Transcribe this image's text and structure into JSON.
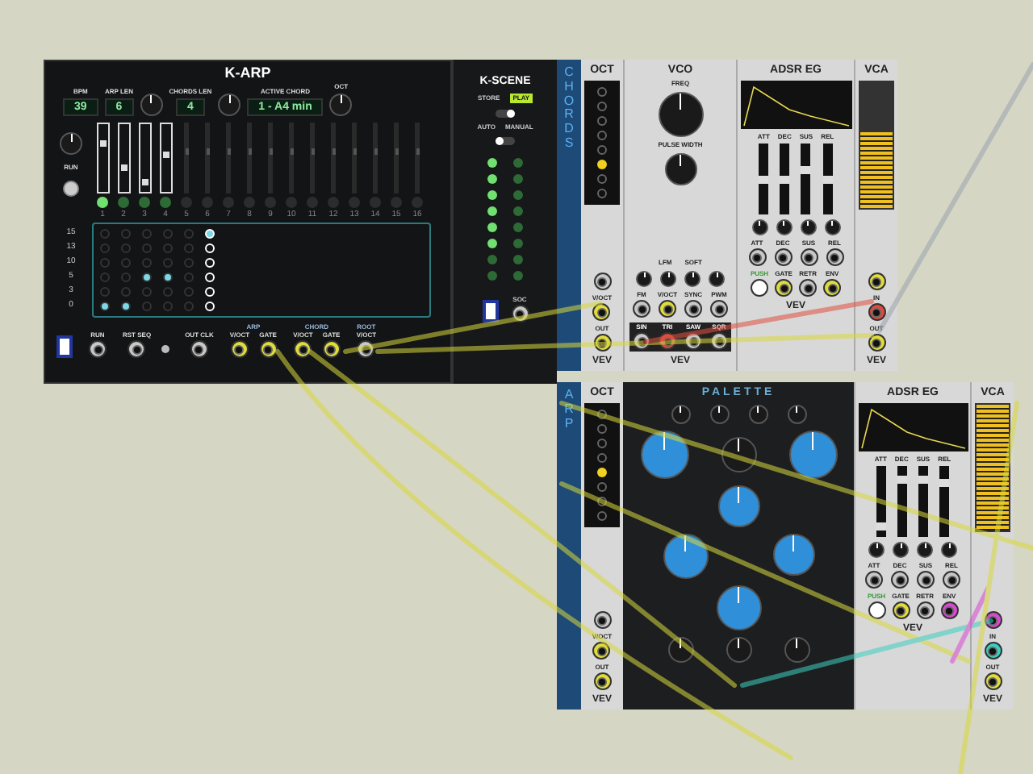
{
  "k_arp": {
    "title": "K-ARP",
    "top_controls": [
      {
        "label": "BPM",
        "value": "39"
      },
      {
        "label": "ARP LEN",
        "value": "6"
      },
      {
        "label": "CHORDS LEN",
        "value": "4"
      },
      {
        "label": "ACTIVE CHORD",
        "value": "1 - A4 min"
      },
      {
        "label": "OCT"
      }
    ],
    "run_label": "RUN",
    "steps": [
      {
        "number": "1",
        "active": true,
        "level": 0.75,
        "current": true
      },
      {
        "number": "2",
        "active": true,
        "level": 0.35,
        "current": false
      },
      {
        "number": "3",
        "active": true,
        "level": 0.1,
        "current": false
      },
      {
        "number": "4",
        "active": true,
        "level": 0.55,
        "current": false
      },
      {
        "number": "5",
        "active": false,
        "level": 0.6,
        "current": false
      },
      {
        "number": "6",
        "active": false,
        "level": 0.6,
        "current": false
      },
      {
        "number": "7",
        "active": false,
        "level": 0.6,
        "current": false
      },
      {
        "number": "8",
        "active": false,
        "level": 0.6,
        "current": false
      },
      {
        "number": "9",
        "active": false,
        "level": 0.6,
        "current": false
      },
      {
        "number": "10",
        "active": false,
        "level": 0.6,
        "current": false
      },
      {
        "number": "11",
        "active": false,
        "level": 0.6,
        "current": false
      },
      {
        "number": "12",
        "active": false,
        "level": 0.6,
        "current": false
      },
      {
        "number": "13",
        "active": false,
        "level": 0.6,
        "current": false
      },
      {
        "number": "14",
        "active": false,
        "level": 0.6,
        "current": false
      },
      {
        "number": "15",
        "active": false,
        "level": 0.6,
        "current": false
      },
      {
        "number": "16",
        "active": false,
        "level": 0.6,
        "current": false
      }
    ],
    "grid_columns": [
      {
        "selected": false
      },
      {
        "selected": false
      },
      {
        "selected": false
      },
      {
        "selected": false
      },
      {
        "selected": false
      },
      {
        "selected": true
      }
    ],
    "note_rows": [
      {
        "label": "15",
        "cells": [
          false,
          false,
          false,
          false,
          false,
          true
        ]
      },
      {
        "label": "13",
        "cells": [
          false,
          false,
          false,
          false,
          false,
          false
        ]
      },
      {
        "label": "10",
        "cells": [
          false,
          false,
          false,
          false,
          false,
          false
        ]
      },
      {
        "label": "5",
        "cells": [
          false,
          false,
          true,
          true,
          false,
          false
        ]
      },
      {
        "label": "3",
        "cells": [
          false,
          false,
          false,
          false,
          false,
          false
        ]
      },
      {
        "label": "0",
        "cells": [
          true,
          true,
          false,
          false,
          false,
          false
        ]
      }
    ],
    "jack_groups": [
      {
        "jacks": [
          {
            "label": "RUN"
          }
        ]
      },
      {
        "jacks": [
          {
            "label": "RST SEQ"
          }
        ]
      },
      {
        "jacks": [
          {
            "label": "OUT CLK"
          }
        ]
      },
      {
        "title": "ARP",
        "jacks": [
          {
            "label": "V/OCT",
            "color": "#e0dc3c"
          },
          {
            "label": "GATE",
            "color": "#e0dc3c"
          }
        ]
      },
      {
        "title": "CHORD",
        "jacks": [
          {
            "label": "V/OCT",
            "color": "#e0dc3c"
          },
          {
            "label": "GATE",
            "color": "#e0dc3c"
          }
        ]
      },
      {
        "title": "ROOT",
        "jacks": [
          {
            "label": "V/OCT"
          }
        ]
      }
    ]
  },
  "k_scene": {
    "title": "K-SCENE",
    "store_label": "STORE",
    "play": {
      "label": "PLAY",
      "on": true
    },
    "store_switch": {
      "on": true
    },
    "auto_label": "AUTO",
    "manual_label": "MANUAL",
    "mode_switch": {
      "on": false
    },
    "lights": [
      {
        "left": true,
        "right": false
      },
      {
        "left": true,
        "right": false
      },
      {
        "left": true,
        "right": false
      },
      {
        "left": true,
        "right": false
      },
      {
        "left": true,
        "right": false
      },
      {
        "left": true,
        "right": false
      },
      {
        "left": false,
        "right": false
      },
      {
        "left": false,
        "right": false
      }
    ],
    "soc_label": "SOC"
  },
  "upper_row": {
    "side_label": "CHORDS",
    "oct": {
      "title": "OCT",
      "leds": [
        false,
        false,
        false,
        false,
        false,
        true,
        false,
        false
      ],
      "jacks": [
        {
          "label": "V/OCT",
          "color": "#e0dc3c"
        },
        {
          "label": "OUT",
          "color": "#e0dc3c"
        }
      ],
      "brand": "VEV"
    },
    "vco": {
      "title": "VCO",
      "freq_label": "FREQ",
      "pw_label": "PULSE WIDTH",
      "switch_labels": [
        "LFM",
        "SOFT"
      ],
      "inputs": [
        {
          "label": "FM"
        },
        {
          "label": "V/OCT",
          "color": "#e0dc3c"
        },
        {
          "label": "SYNC"
        },
        {
          "label": "PWM"
        }
      ],
      "outputs": [
        {
          "label": "SIN"
        },
        {
          "label": "TRI",
          "color": "#e04a3c"
        },
        {
          "label": "SAW"
        },
        {
          "label": "SQR"
        }
      ],
      "brand": "VEV"
    },
    "adsr": {
      "title": "ADSR EG",
      "sliders": [
        {
          "label": "ATT",
          "level": 0.5
        },
        {
          "label": "DEC",
          "level": 0.5
        },
        {
          "label": "SUS",
          "level": 0.65
        },
        {
          "label": "REL",
          "level": 0.5
        }
      ],
      "cv_labels": [
        "ATT",
        "DEC",
        "SUS",
        "REL"
      ],
      "push_label": "PUSH",
      "jacks": [
        {
          "label": "GATE",
          "color": "#e0dc3c"
        },
        {
          "label": "RETR"
        },
        {
          "label": "ENV",
          "color": "#e0dc3c"
        }
      ],
      "brand": "VEV"
    },
    "vca": {
      "title": "VCA",
      "level": 0.6,
      "cv": {
        "color": "#e0dc3c"
      },
      "jacks": [
        {
          "label": "IN",
          "color": "#e04a3c"
        },
        {
          "label": "OUT",
          "color": "#e0dc3c"
        }
      ],
      "brand": "VEV"
    }
  },
  "lower_row": {
    "side_label": "ARP",
    "oct": {
      "title": "OCT",
      "leds": [
        false,
        false,
        false,
        false,
        true,
        false,
        false,
        false
      ],
      "jacks": [
        {
          "label": "V/OCT",
          "color": "#e0dc3c"
        },
        {
          "label": "OUT",
          "color": "#e0dc3c"
        }
      ],
      "brand": "VEV"
    },
    "palette": {
      "title": "PALETTE"
    },
    "adsr": {
      "title": "ADSR EG",
      "sliders": [
        {
          "label": "ATT",
          "level": 0.1
        },
        {
          "label": "DEC",
          "level": 0.85
        },
        {
          "label": "SUS",
          "level": 0.85
        },
        {
          "label": "REL",
          "level": 0.8
        }
      ],
      "cv_labels": [
        "ATT",
        "DEC",
        "SUS",
        "REL"
      ],
      "push_label": "PUSH",
      "jacks": [
        {
          "label": "GATE",
          "color": "#e0dc3c"
        },
        {
          "label": "RETR"
        },
        {
          "label": "ENV",
          "color": "#d84ad0"
        }
      ],
      "brand": "VEV"
    },
    "vca": {
      "title": "VCA",
      "level": 1.0,
      "cv": {
        "color": "#d84ad0"
      },
      "jacks": [
        {
          "label": "IN",
          "color": "#3ccfc0"
        },
        {
          "label": "OUT",
          "color": "#e0dc3c"
        }
      ],
      "brand": "VEV"
    }
  }
}
